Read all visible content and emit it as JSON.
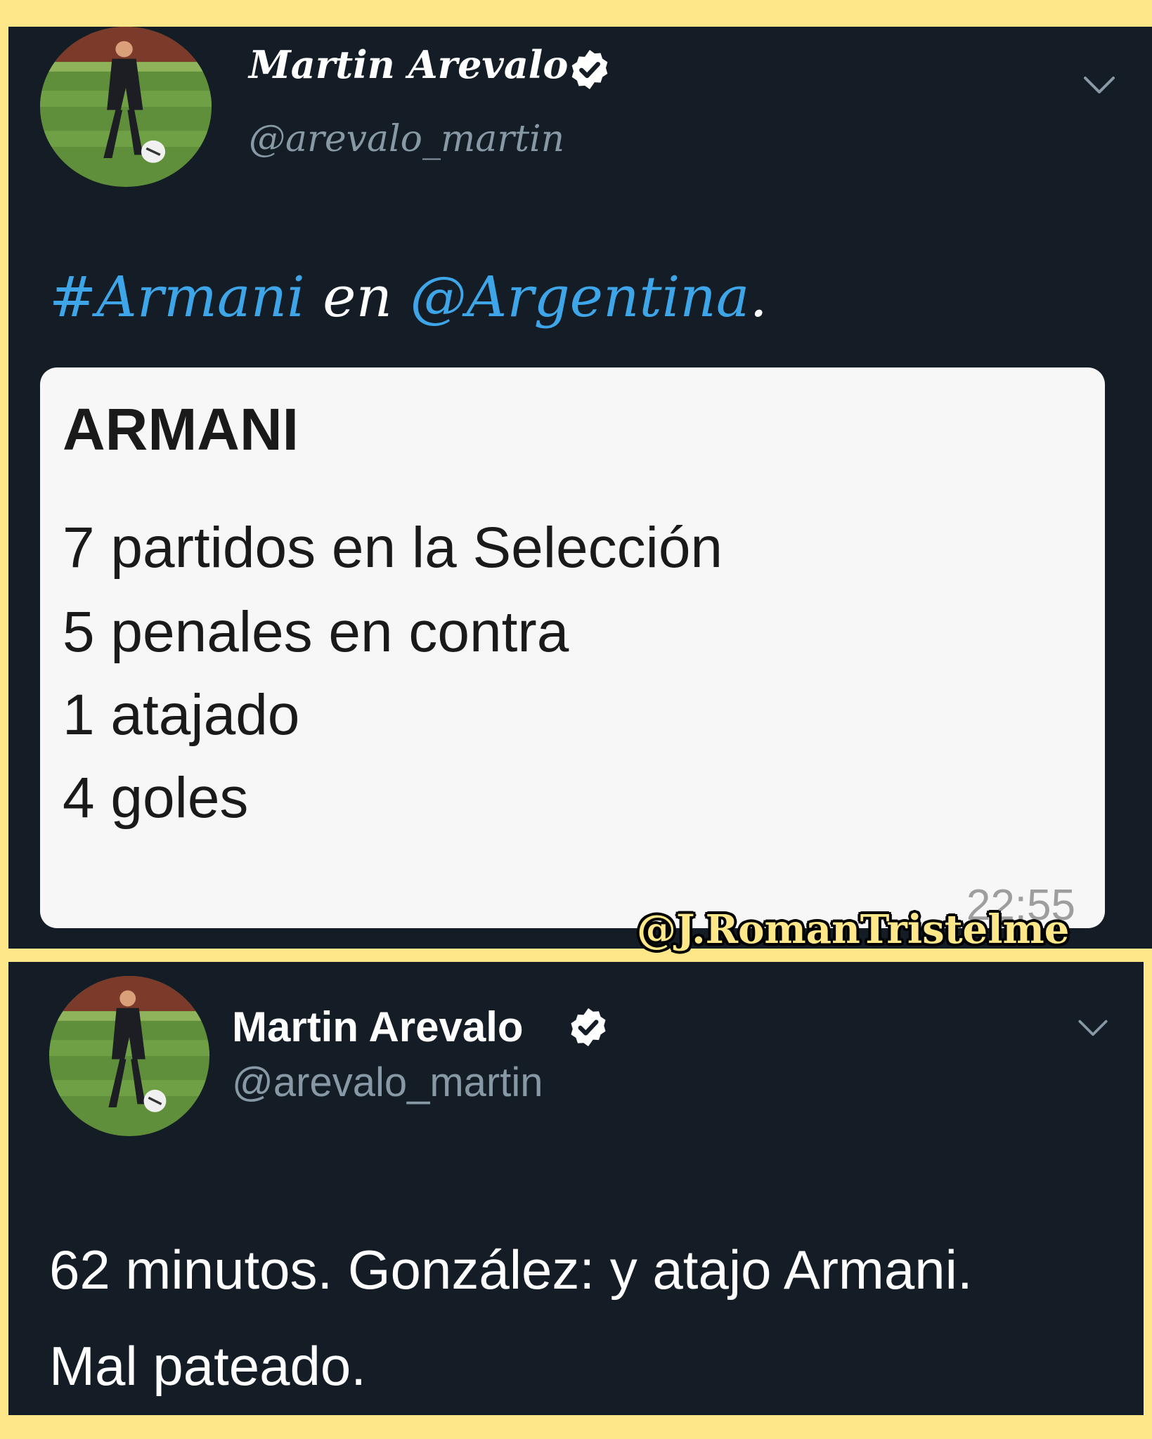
{
  "tweets": [
    {
      "author": {
        "name": "Martin Arevalo",
        "handle": "@arevalo_martin",
        "verified": true
      },
      "text_parts": [
        {
          "type": "hashtag",
          "text": "#Armani"
        },
        {
          "type": "text",
          "text": " en "
        },
        {
          "type": "mention",
          "text": "@Argentina"
        },
        {
          "type": "text",
          "text": "."
        }
      ],
      "attached_message": {
        "title": "ARMANI",
        "lines": [
          "7 partidos en la Selección",
          "5 penales en contra",
          "1 atajado",
          "4 goles"
        ],
        "time": "22:55"
      }
    },
    {
      "author": {
        "name": "Martin Arevalo",
        "handle": "@arevalo_martin",
        "verified": true
      },
      "text_lines": [
        "62 minutos. González: y atajo Armani.",
        "Mal pateado."
      ]
    }
  ],
  "watermark": "@J.RomanTristelme",
  "icons": {
    "verified": "verified-badge-icon",
    "menu": "chevron-down-icon",
    "avatar": "profile-photo"
  },
  "colors": {
    "background_frame": "#fde789",
    "tweet_background": "#141d26",
    "link": "#3ea6e8",
    "secondary_text": "#8899a6"
  }
}
